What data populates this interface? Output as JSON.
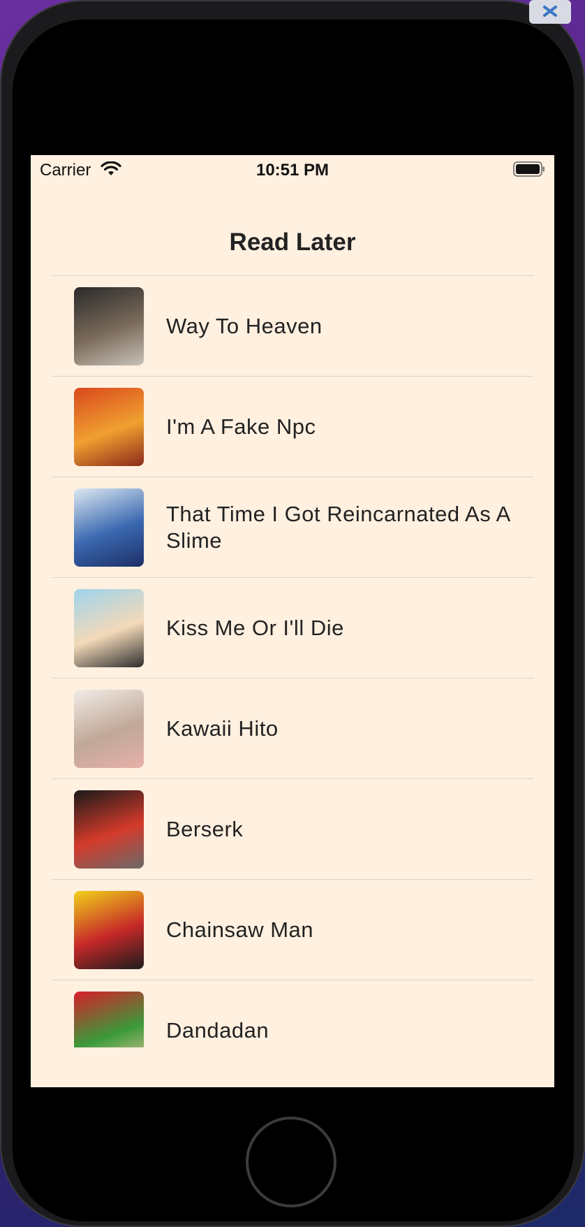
{
  "status_bar": {
    "carrier": "Carrier",
    "time": "10:51 PM",
    "icons": [
      "wifi-icon",
      "battery-icon"
    ]
  },
  "nav": {
    "title": "Read Later"
  },
  "items": [
    {
      "title": "Way To Heaven",
      "cover_colors": [
        "#2a2a2a",
        "#7a6a5a",
        "#c9c2b8"
      ]
    },
    {
      "title": "I'm A Fake Npc",
      "cover_colors": [
        "#d9481d",
        "#f0a030",
        "#8a2a1a"
      ]
    },
    {
      "title": "That Time I Got Reincarnated As A Slime",
      "cover_colors": [
        "#dde9f2",
        "#3a68b0",
        "#1d2f66"
      ]
    },
    {
      "title": "Kiss Me Or I'll Die",
      "cover_colors": [
        "#9fd4ec",
        "#f3d9b8",
        "#2d2d2d"
      ]
    },
    {
      "title": "Kawaii Hito",
      "cover_colors": [
        "#f2ece6",
        "#c0a898",
        "#e6b0a8"
      ]
    },
    {
      "title": "Berserk",
      "cover_colors": [
        "#1a1a1a",
        "#d43a2a",
        "#6a6a6a"
      ]
    },
    {
      "title": "Chainsaw Man",
      "cover_colors": [
        "#f1d21a",
        "#c62828",
        "#1c1c1c"
      ]
    },
    {
      "title": "Dandadan",
      "cover_colors": [
        "#d81e2a",
        "#3a9a3a",
        "#f2c9a0"
      ]
    }
  ],
  "colors": {
    "screen_background": "#fff0e0",
    "divider": "#ddd3c7",
    "text": "#222222"
  }
}
